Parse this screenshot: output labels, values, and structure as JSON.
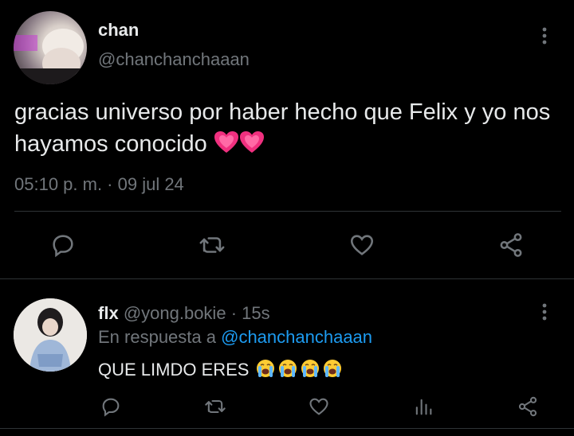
{
  "main_tweet": {
    "display_name": "chan",
    "handle": "@chanchanchaaan",
    "text": "gracias universo por haber hecho que Felix y yo nos hayamos conocido",
    "emojis": [
      "growing-heart",
      "growing-heart"
    ],
    "timestamp": "05:10 p. m. · 09 jul 24",
    "actions": [
      "reply-icon",
      "retweet-icon",
      "like-icon",
      "share-icon"
    ]
  },
  "reply_tweet": {
    "display_name": "flx",
    "handle": "@yong.bokie",
    "time_sep": "·",
    "time": "15s",
    "reply_prefix": "En respuesta a",
    "reply_to": "@chanchanchaaan",
    "text": "QUE LIMDO ERES",
    "emojis": [
      "loudly-crying-face",
      "loudly-crying-face",
      "loudly-crying-face",
      "loudly-crying-face"
    ],
    "actions": [
      "reply-icon",
      "retweet-icon",
      "like-icon",
      "views-icon",
      "share-icon"
    ]
  },
  "colors": {
    "background": "#000000",
    "text": "#e7e9ea",
    "muted": "#71767b",
    "link": "#1d9bf0",
    "divider": "#2f3336",
    "heart_emoji": "#f0307f"
  }
}
